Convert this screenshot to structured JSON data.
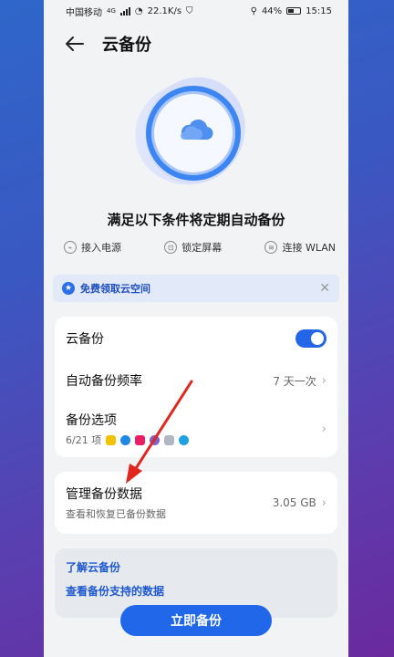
{
  "status_bar": {
    "carrier": "中国移动",
    "network_type": "4G",
    "speed": "22.1K/s",
    "battery": "44%",
    "time": "15:15"
  },
  "header": {
    "title": "云备份"
  },
  "conditions": {
    "title": "满足以下条件将定期自动备份",
    "items": [
      {
        "icon": "plug-icon",
        "label": "接入电源"
      },
      {
        "icon": "lock-icon",
        "label": "锁定屏幕"
      },
      {
        "icon": "wifi-icon",
        "label": "连接 WLAN"
      }
    ]
  },
  "promo": {
    "text": "免费领取云空间"
  },
  "settings": {
    "cloud_backup_label": "云备份",
    "cloud_backup_enabled": true,
    "frequency_label": "自动备份频率",
    "frequency_value": "7 天一次",
    "options_label": "备份选项",
    "options_count": "6/21 项"
  },
  "manage": {
    "label": "管理备份数据",
    "subtitle": "查看和恢复已备份数据",
    "size": "3.05 GB"
  },
  "info_links": [
    "了解云备份",
    "查看备份支持的数据"
  ],
  "action": {
    "label": "立即备份"
  },
  "colors": {
    "accent": "#2167ea",
    "annotation_arrow": "#e0261e"
  }
}
